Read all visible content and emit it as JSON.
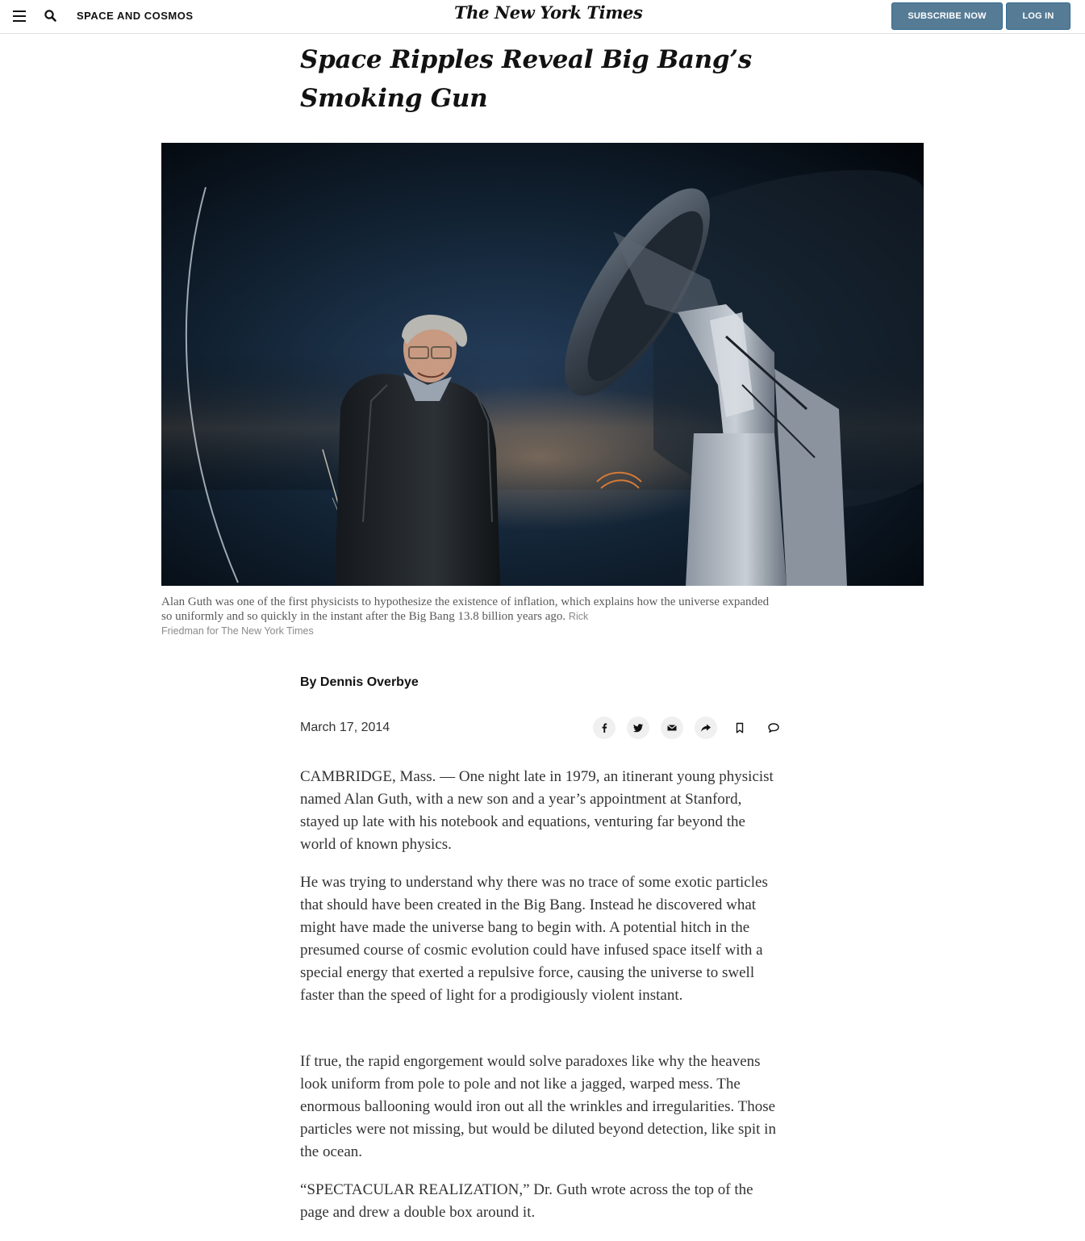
{
  "header": {
    "section": "SPACE AND COSMOS",
    "logo": "The New York Times",
    "subscribe_label": "SUBSCRIBE NOW",
    "login_label": "LOG IN",
    "colors": {
      "button_bg": "#567b95",
      "button_text": "#ffffff"
    },
    "icons": [
      "menu-icon",
      "search-icon"
    ]
  },
  "article": {
    "headline_line1": "Space Ripples Reveal Big Bang’s",
    "headline_line2": "Smoking Gun",
    "caption": "Alan Guth was one of the first physicists to hypothesize the existence of inflation, which explains how the universe expanded so uniformly and so quickly in the instant after the Big Bang 13.8 billion years ago.",
    "credit_part1": "Rick",
    "credit_part2": "Friedman for The New York Times",
    "byline_prefix": "By",
    "byline_author": "Dennis Overbye",
    "date": "March 17, 2014",
    "share_icons": [
      "facebook-icon",
      "twitter-icon",
      "email-icon",
      "share-icon",
      "bookmark-icon",
      "comment-icon"
    ],
    "paragraphs": [
      "CAMBRIDGE, Mass. — One night late in 1979, an itinerant young physicist named Alan Guth, with a new son and a year’s appointment at Stanford, stayed up late with his notebook and equations, venturing far beyond the world of known physics.",
      "He was trying to understand why there was no trace of some exotic particles that should have been created in the Big Bang. Instead he discovered what might have made the universe bang to begin with. A potential hitch in the presumed course of cosmic evolution could have infused space itself with a special energy that exerted a repulsive force, causing the universe to swell faster than the speed of light for a prodigiously violent instant.",
      "If true, the rapid engorgement would solve paradoxes like why the heavens look uniform from pole to pole and not like a jagged, warped mess. The enormous ballooning would iron out all the wrinkles and irregularities. Those particles were not missing, but would be diluted beyond detection, like spit in the ocean.",
      "“SPECTACULAR REALIZATION,” Dr. Guth wrote across the top of the page and drew a double box around it."
    ]
  }
}
